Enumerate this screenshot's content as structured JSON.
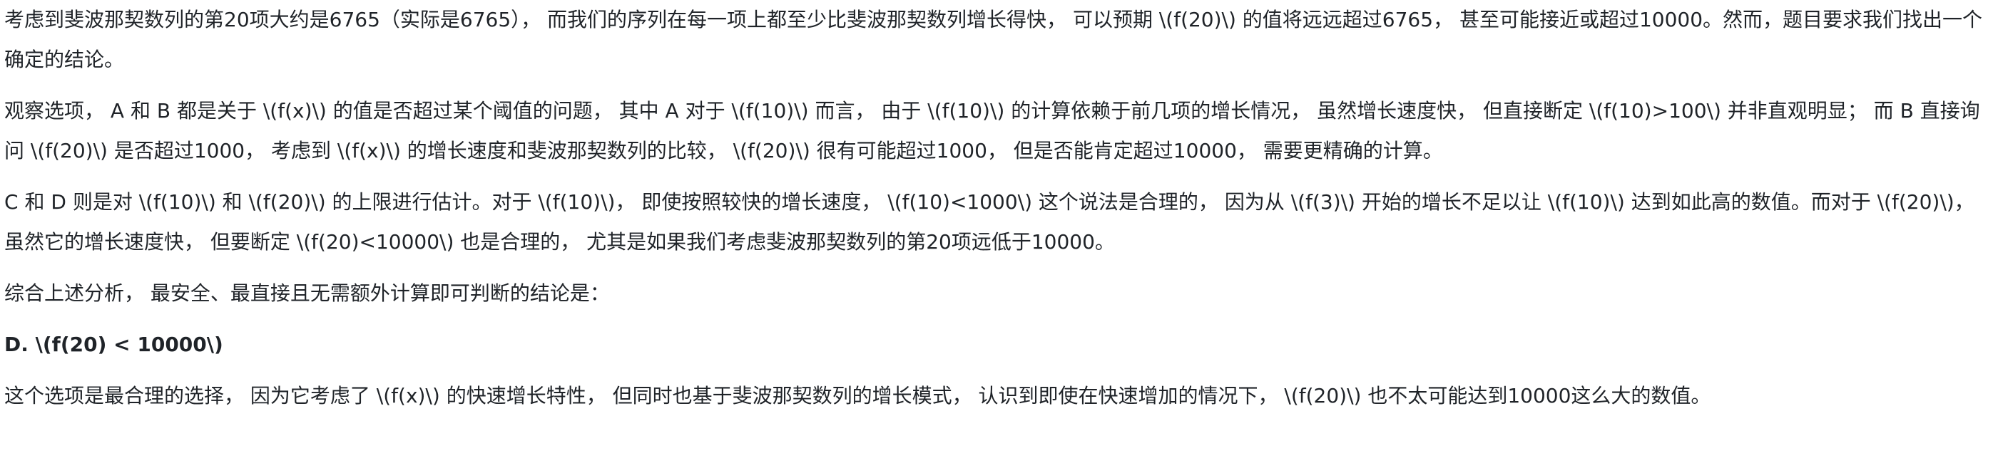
{
  "paragraphs": [
    "考虑到斐波那契数列的第20项大约是6765（实际是6765），  而我们的序列在每一项上都至少比斐波那契数列增长得快，  可以预期 \\(f(20)\\) 的值将远远超过6765，  甚至可能接近或超过10000。然而，题目要求我们找出一个确定的结论。",
    "观察选项，  A 和 B 都是关于 \\(f(x)\\) 的值是否超过某个阈值的问题，  其中 A 对于 \\(f(10)\\) 而言，  由于 \\(f(10)\\) 的计算依赖于前几项的增长情况，  虽然增长速度快，  但直接断定 \\(f(10)>100\\) 并非直观明显；  而 B 直接询问 \\(f(20)\\) 是否超过1000，  考虑到 \\(f(x)\\) 的增长速度和斐波那契数列的比较，  \\(f(20)\\) 很有可能超过1000，  但是否能肯定超过10000，  需要更精确的计算。",
    "C 和 D 则是对 \\(f(10)\\) 和 \\(f(20)\\) 的上限进行估计。对于 \\(f(10)\\)，  即使按照较快的增长速度，  \\(f(10)<1000\\) 这个说法是合理的，  因为从 \\(f(3)\\) 开始的增长不足以让 \\(f(10)\\) 达到如此高的数值。而对于 \\(f(20)\\)，  虽然它的增长速度快，  但要断定 \\(f(20)<10000\\) 也是合理的，  尤其是如果我们考虑斐波那契数列的第20项远低于10000。",
    "综合上述分析，  最安全、最直接且无需额外计算即可判断的结论是：",
    "D. \\(f(20) < 10000\\)",
    "这个选项是最合理的选择，  因为它考虑了 \\(f(x)\\) 的快速增长特性，  但同时也基于斐波那契数列的增长模式，  认识到即使在快速增加的情况下，  \\(f(20)\\) 也不太可能达到10000这么大的数值。"
  ]
}
